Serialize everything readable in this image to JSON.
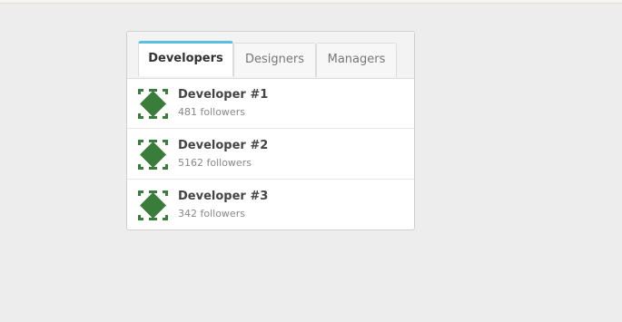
{
  "tabs": [
    {
      "label": "Developers",
      "active": true
    },
    {
      "label": "Designers",
      "active": false
    },
    {
      "label": "Managers",
      "active": false
    }
  ],
  "colors": {
    "accent": "#5bc0de",
    "avatar_green": "#3a7d3a",
    "background": "#ededed"
  },
  "avatar_icon": "green-diamond-identicon",
  "items": [
    {
      "name": "Developer #1",
      "followers": "481 followers"
    },
    {
      "name": "Developer #2",
      "followers": "5162 followers"
    },
    {
      "name": "Developer #3",
      "followers": "342 followers"
    }
  ]
}
